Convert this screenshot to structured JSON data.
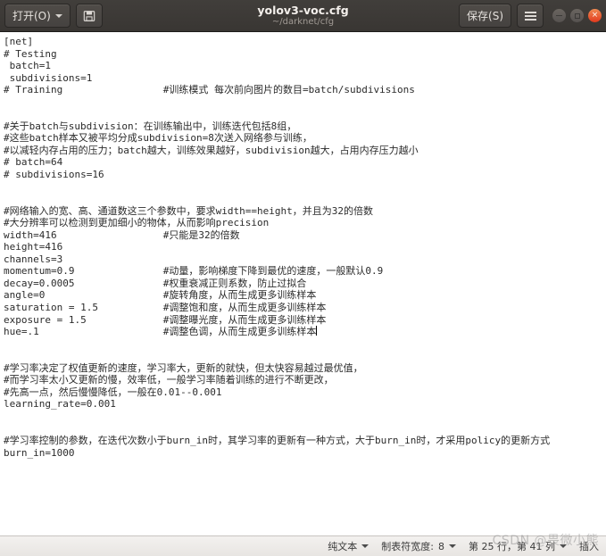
{
  "titlebar": {
    "open_button": "打开(O)",
    "save_icon_name": "save-disk-icon",
    "filename": "yolov3-voc.cfg",
    "filepath": "~/darknet/cfg",
    "save_button": "保存(S)",
    "menu_icon_name": "hamburger-menu-icon",
    "minimize_label": "",
    "maximize_label": "",
    "close_label": "×"
  },
  "editor": {
    "lines": [
      "[net]",
      "# Testing",
      " batch=1",
      " subdivisions=1",
      "# Training                 #训练模式 每次前向图片的数目=batch/subdivisions",
      "",
      "",
      "#关于batch与subdivision：在训练输出中，训练迭代包括8组，",
      "#这些batch样本又被平均分成subdivision=8次送入网络参与训练，",
      "#以减轻内存占用的压力；batch越大，训练效果越好，subdivision越大，占用内存压力越小",
      "# batch=64",
      "# subdivisions=16",
      "",
      "",
      "#网络输入的宽、高、通道数这三个参数中，要求width==height，并且为32的倍数",
      "#大分辨率可以检测到更加细小的物体，从而影响precision",
      "width=416                  #只能是32的倍数",
      "height=416",
      "channels=3",
      "momentum=0.9               #动量，影响梯度下降到最优的速度，一般默认0.9",
      "decay=0.0005               #权重衰减正则系数，防止过拟合",
      "angle=0                    #旋转角度，从而生成更多训练样本",
      "saturation = 1.5           #调整饱和度，从而生成更多训练样本",
      "exposure = 1.5             #调整曝光度，从而生成更多训练样本",
      "hue=.1                     #调整色调，从而生成更多训练样本",
      "",
      "",
      "#学习率决定了权值更新的速度，学习率大，更新的就快，但太快容易越过最优值，",
      "#而学习率太小又更新的慢，效率低，一般学习率随着训练的进行不断更改，",
      "#先高一点，然后慢慢降低，一般在0.01--0.001",
      "learning_rate=0.001",
      "",
      "",
      "#学习率控制的参数，在迭代次数小于burn_in时，其学习率的更新有一种方式，大于burn_in时，才采用policy的更新方式",
      "burn_in=1000"
    ],
    "cursor_line_index": 24
  },
  "statusbar": {
    "syntax": "纯文本",
    "tab_width_label": "制表符宽度:",
    "tab_width_value": "8",
    "position": "第 25 行，第 41 列",
    "insert_mode": "插入"
  },
  "watermark": "CSDN @畏微小熊"
}
